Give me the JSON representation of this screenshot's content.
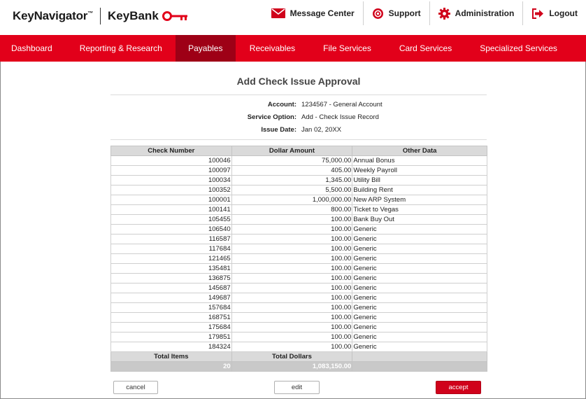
{
  "brand": {
    "product": "KeyNavigator",
    "tm": "™",
    "bank": "KeyBank"
  },
  "toplinks": [
    {
      "label": "Message Center",
      "icon": "envelope-icon"
    },
    {
      "label": "Support",
      "icon": "life-ring-icon"
    },
    {
      "label": "Administration",
      "icon": "gear-icon"
    },
    {
      "label": "Logout",
      "icon": "logout-icon"
    }
  ],
  "nav": [
    {
      "label": "Dashboard"
    },
    {
      "label": "Reporting & Research"
    },
    {
      "label": "Payables"
    },
    {
      "label": "Receivables"
    },
    {
      "label": "File Services"
    },
    {
      "label": "Card Services"
    },
    {
      "label": "Specialized Services"
    }
  ],
  "colors": {
    "brand_red": "#e2001a",
    "active_tab": "#9e0016"
  },
  "page": {
    "title": "Add Check Issue Approval",
    "account_label": "Account:",
    "account_value": "1234567 - General Account",
    "service_label": "Service Option:",
    "service_value": "Add - Check Issue Record",
    "date_label": "Issue Date:",
    "date_value": "Jan 02, 20XX"
  },
  "table": {
    "headers": [
      "Check Number",
      "Dollar Amount",
      "Other Data"
    ],
    "rows": [
      [
        "100046",
        "75,000.00",
        "Annual Bonus"
      ],
      [
        "100097",
        "405.00",
        "Weekly Payroll"
      ],
      [
        "100034",
        "1,345.00",
        "Utility Bill"
      ],
      [
        "100352",
        "5,500.00",
        "Building Rent"
      ],
      [
        "100001",
        "1,000,000.00",
        "New ARP System"
      ],
      [
        "100141",
        "800.00",
        "Ticket to Vegas"
      ],
      [
        "105455",
        "100.00",
        "Bank Buy Out"
      ],
      [
        "106540",
        "100.00",
        "Generic"
      ],
      [
        "116587",
        "100.00",
        "Generic"
      ],
      [
        "117684",
        "100.00",
        "Generic"
      ],
      [
        "121465",
        "100.00",
        "Generic"
      ],
      [
        "135481",
        "100.00",
        "Generic"
      ],
      [
        "136875",
        "100.00",
        "Generic"
      ],
      [
        "145687",
        "100.00",
        "Generic"
      ],
      [
        "149687",
        "100.00",
        "Generic"
      ],
      [
        "157684",
        "100.00",
        "Generic"
      ],
      [
        "168751",
        "100.00",
        "Generic"
      ],
      [
        "175684",
        "100.00",
        "Generic"
      ],
      [
        "179851",
        "100.00",
        "Generic"
      ],
      [
        "184324",
        "100.00",
        "Generic"
      ]
    ],
    "total_items_label": "Total Items",
    "total_dollars_label": "Total Dollars",
    "total_items": "20",
    "total_dollars": "1,083,150.00"
  },
  "buttons": {
    "cancel": "cancel",
    "edit": "edit",
    "accept": "accept"
  }
}
